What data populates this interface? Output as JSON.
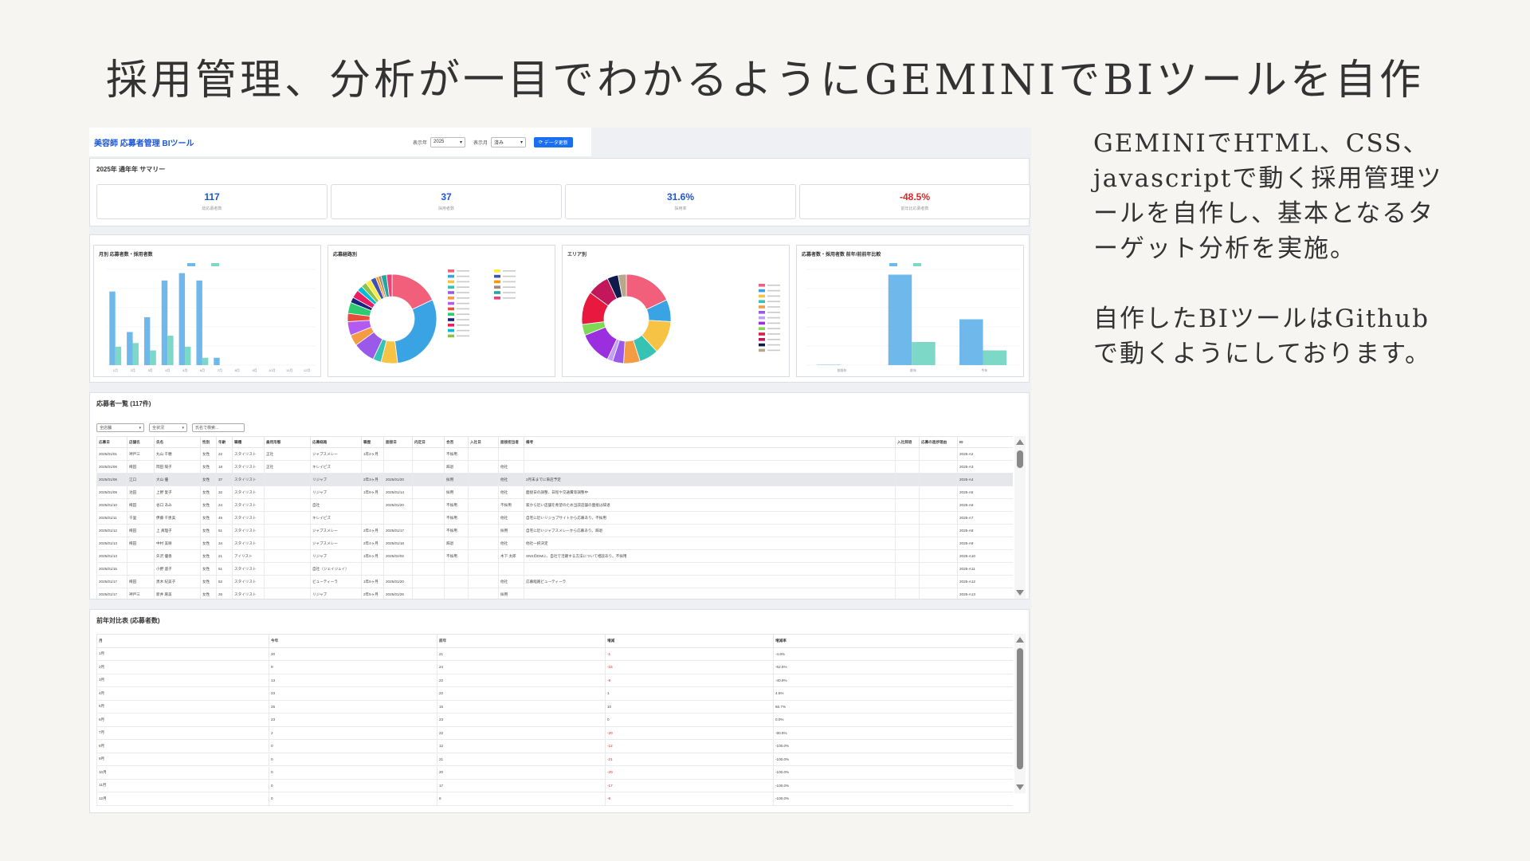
{
  "slide": {
    "title": "採用管理、分析が一目でわかるようにGEMINIでBIツールを自作",
    "paragraph1": "GEMINIでHTML、CSS、javascriptで動く採用管理ツールを自作し、基本となるターゲット分析を実施。",
    "paragraph2": "自作したBIツールはGithubで動くようにしております。"
  },
  "app": {
    "title": "美容師 応募者管理 BIツール",
    "year_label": "表示年",
    "year_value": "2025",
    "month_label": "表示月",
    "month_value": "済み",
    "update_button": "データ更新",
    "summary_title": "2025年 通年年 サマリー",
    "kpis": [
      {
        "value": "117",
        "label": "総応募者数",
        "color": "#1a56d6"
      },
      {
        "value": "37",
        "label": "採用者数",
        "color": "#1a56d6"
      },
      {
        "value": "31.6%",
        "label": "採用率",
        "color": "#1a56d6"
      },
      {
        "value": "-48.5%",
        "label": "前年比応募者数",
        "color": "#e02424"
      }
    ],
    "charts": {
      "monthly_title": "月別 応募者数・採用者数",
      "source_title": "応募経路別",
      "area_title": "エリア別",
      "yoy_title": "応募者数・採用者数 前年/前前年比較"
    },
    "list": {
      "title": "応募者一覧 (117件)",
      "filter1": "全店舗",
      "filter2": "全状況",
      "search_placeholder": "氏名で検索...",
      "columns": [
        "応募日",
        "店舗名",
        "氏名",
        "性別",
        "年齢",
        "職種",
        "雇用形態",
        "応募経路",
        "職歴",
        "面接日",
        "内定日",
        "合否",
        "入社日",
        "面接担当者",
        "備考",
        "入社辞退",
        "応募の進捗理由",
        "ID"
      ],
      "rows": [
        [
          "2025/01/01",
          "神戸三",
          "丸山 千穂",
          "女性",
          "22",
          "スタイリスト",
          "正社",
          "ジャブスメレー",
          "1年2ヶ月",
          "",
          "",
          "不採用",
          "",
          "",
          "",
          "",
          "",
          "2025-A2"
        ],
        [
          "2025/01/06",
          "梅田",
          "岡田 陽子",
          "女性",
          "18",
          "スタイリスト",
          "正社",
          "キレイビズ",
          "",
          "",
          "",
          "辞退",
          "",
          "他社",
          "",
          "",
          "",
          "2025-A3"
        ],
        [
          "2025/01/06",
          "江口",
          "大山 優",
          "女性",
          "37",
          "スタイリスト",
          "",
          "リジャブ",
          "2年3ヶ月",
          "2025/01/20",
          "",
          "採用",
          "",
          "他社",
          "2月末までに来店予定",
          "",
          "",
          "2025-A4"
        ],
        [
          "2025/01/09",
          "池田",
          "上野 愛子",
          "女性",
          "32",
          "スタイリスト",
          "",
          "リジャブ",
          "1年8ヶ月",
          "2025/01/14",
          "",
          "採用",
          "",
          "他社",
          "面接日の調整、日程や交通費等調整中",
          "",
          "",
          "2025-A5"
        ],
        [
          "2025/01/10",
          "梅田",
          "谷口 あみ",
          "女性",
          "24",
          "スタイリスト",
          "",
          "自社",
          "",
          "2025/01/20",
          "",
          "不採用",
          "",
          "不採用",
          "家から近い店舗を希望のため当該店舗の面接は辞退",
          "",
          "",
          "2025-A6"
        ],
        [
          "2025/01/11",
          "千里",
          "伊藤 千恵美",
          "女性",
          "45",
          "スタイリスト",
          "",
          "キレイビズ",
          "",
          "",
          "",
          "不採用",
          "",
          "他社",
          "自宅に近いリジョブサイトから応募あり。不採用",
          "",
          "",
          "2025-A7"
        ],
        [
          "2025/01/12",
          "梅田",
          "上 真理子",
          "女性",
          "51",
          "スタイリスト",
          "",
          "ジャブスメレー",
          "2年4ヶ月",
          "2025/01/17",
          "",
          "不採用",
          "",
          "採用",
          "自宅に近いジャブスメレーから応募あり。辞退",
          "",
          "",
          "2025-A8"
        ],
        [
          "2025/01/13",
          "梅田",
          "中村 美咲",
          "女性",
          "34",
          "スタイリスト",
          "",
          "ジャブスメレー",
          "2年4ヶ月",
          "2025/01/18",
          "",
          "辞退",
          "",
          "他社",
          "他社一択決定",
          "",
          "",
          "2025-A9"
        ],
        [
          "2025/01/13",
          "",
          "矢沢 優香",
          "女性",
          "21",
          "アイリスト",
          "",
          "リジャブ",
          "1年6ヶ月",
          "2025/02/02",
          "",
          "不採用",
          "",
          "木下 太郎",
          "SNSのDMに、自社で活躍する方法について相談あり。不採用",
          "",
          "",
          "2025-A10"
        ],
        [
          "2025/01/15",
          "",
          "小野 遥子",
          "女性",
          "51",
          "スタイリスト",
          "",
          "自社（ジェイジュイ）",
          "",
          "",
          "",
          "",
          "",
          "",
          "",
          "",
          "",
          "2025-A11"
        ],
        [
          "2025/01/17",
          "梅田",
          "黒木 紀美子",
          "女性",
          "52",
          "スタイリスト",
          "",
          "ビューティーラ",
          "1年6ヶ月",
          "2025/01/20",
          "",
          "",
          "",
          "他社",
          "応募経路ビューティーラ",
          "",
          "",
          "2025-A12"
        ],
        [
          "2025/01/17",
          "神戸三",
          "新井 麻美",
          "女性",
          "26",
          "スタイリスト",
          "",
          "リジャブ",
          "2年5ヶ月",
          "2025/01/26",
          "",
          "",
          "",
          "採用",
          "",
          "",
          "",
          "2025-A13"
        ]
      ]
    },
    "compare": {
      "title": "前年対比表 (応募者数)",
      "columns": [
        "月",
        "今年",
        "前年",
        "増減",
        "増減率"
      ],
      "rows": [
        [
          "1月",
          "20",
          "21",
          "-1",
          "-4.8%"
        ],
        [
          "2月",
          "9",
          "24",
          "-15",
          "-62.5%"
        ],
        [
          "3月",
          "13",
          "22",
          "-9",
          "-40.9%"
        ],
        [
          "4月",
          "23",
          "22",
          "1",
          "4.5%"
        ],
        [
          "5月",
          "25",
          "15",
          "10",
          "66.7%"
        ],
        [
          "6月",
          "23",
          "23",
          "0",
          "0.0%"
        ],
        [
          "7月",
          "2",
          "22",
          "-20",
          "-90.9%"
        ],
        [
          "8月",
          "0",
          "12",
          "-12",
          "-100.0%"
        ],
        [
          "9月",
          "0",
          "21",
          "-21",
          "-100.0%"
        ],
        [
          "10月",
          "0",
          "20",
          "-20",
          "-100.0%"
        ],
        [
          "11月",
          "0",
          "17",
          "-17",
          "-100.0%"
        ],
        [
          "12月",
          "0",
          "8",
          "-8",
          "-100.0%"
        ]
      ]
    }
  },
  "chart_data": [
    {
      "type": "bar",
      "title": "月別 応募者数・採用者数",
      "categories": [
        "1月",
        "2月",
        "3月",
        "4月",
        "5月",
        "6月",
        "7月",
        "8月",
        "9月",
        "10月",
        "11月",
        "12月"
      ],
      "series": [
        {
          "name": "応募者数",
          "values": [
            20,
            9,
            13,
            23,
            25,
            23,
            2,
            0,
            0,
            0,
            0,
            0
          ],
          "color": "#6fb8ec"
        },
        {
          "name": "採用者数",
          "values": [
            5,
            6,
            4,
            8,
            5,
            2,
            0,
            0,
            0,
            0,
            0,
            0
          ],
          "color": "#7dd8c8"
        }
      ],
      "ylim": [
        0,
        26
      ]
    },
    {
      "type": "pie",
      "title": "応募経路別",
      "values": [
        18,
        30,
        6,
        3,
        8,
        4,
        5,
        3,
        4,
        2,
        3,
        2,
        2,
        2,
        2,
        1,
        1,
        2,
        2
      ],
      "colors": [
        "#f25f7a",
        "#3aa3e3",
        "#f6c344",
        "#37c3b4",
        "#9b59ea",
        "#f39c44",
        "#b35af0",
        "#e74c3c",
        "#2ecc71",
        "#1a237e",
        "#e91e63",
        "#00bcd4",
        "#8bc34a",
        "#ffeb3b",
        "#3f51b5",
        "#ff9800",
        "#a1887f",
        "#26a69a",
        "#ec407a"
      ]
    },
    {
      "type": "pie",
      "title": "エリア別",
      "values": [
        18,
        8,
        12,
        7,
        6,
        4,
        2,
        12,
        4,
        12,
        8,
        4,
        3
      ],
      "colors": [
        "#f25f7a",
        "#3aa3e3",
        "#f6c344",
        "#37c3b4",
        "#f39c44",
        "#9b59ea",
        "#c0a0f0",
        "#9b2fe0",
        "#7ed957",
        "#e8193f",
        "#c2185b",
        "#0d1a4a",
        "#b7a88a"
      ]
    },
    {
      "type": "bar",
      "title": "応募者数・採用者数 前年/前前年比較",
      "categories": [
        "前前年",
        "前年",
        "今年"
      ],
      "series": [
        {
          "name": "応募者数",
          "values": [
            1,
            227,
            115
          ],
          "color": "#6fb8ec"
        },
        {
          "name": "採用者数",
          "values": [
            0,
            58,
            37
          ],
          "color": "#7dd8c8"
        }
      ],
      "ylim": [
        0,
        240
      ]
    }
  ]
}
